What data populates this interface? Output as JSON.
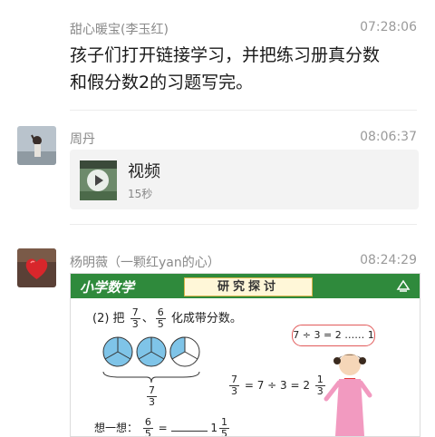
{
  "messages": [
    {
      "sender": "甜心暖宝(李玉红)",
      "time": "07:28:06",
      "text_line1": "孩子们打开链接学习，并把练习册真分数",
      "text_line2": "和假分数2的习题写完。"
    },
    {
      "sender": "周丹",
      "time": "08:06:37",
      "video": {
        "title": "视频",
        "duration": "15秒"
      }
    },
    {
      "sender": "杨明薇（一颗红yan的心）",
      "time": "08:24:29",
      "image": {
        "header_title": "小学数学",
        "header_box": "研究探讨",
        "question_prefix": "(2) 把",
        "q_frac1_num": "7",
        "q_frac1_den": "3",
        "q_sep": "、",
        "q_frac2_num": "6",
        "q_frac2_den": "5",
        "question_suffix": "化成带分数。",
        "bubble_text": "7 ÷ 3 = 2 …… 1",
        "circle_frac_num": "7",
        "circle_frac_den": "3",
        "eq_num": "7",
        "eq_den": "3",
        "eq_mid": "= 7 ÷ 3 = 2",
        "eq_res_num": "1",
        "eq_res_den": "3",
        "think_label": "想一想：",
        "think_num": "6",
        "think_den": "5",
        "think_eq": "=",
        "think_whole": "1",
        "think_res_num": "1",
        "think_res_den": "5"
      }
    }
  ],
  "colors": {
    "header_green": "#2f8a3c",
    "pie_blue": "#7fc4e8"
  }
}
